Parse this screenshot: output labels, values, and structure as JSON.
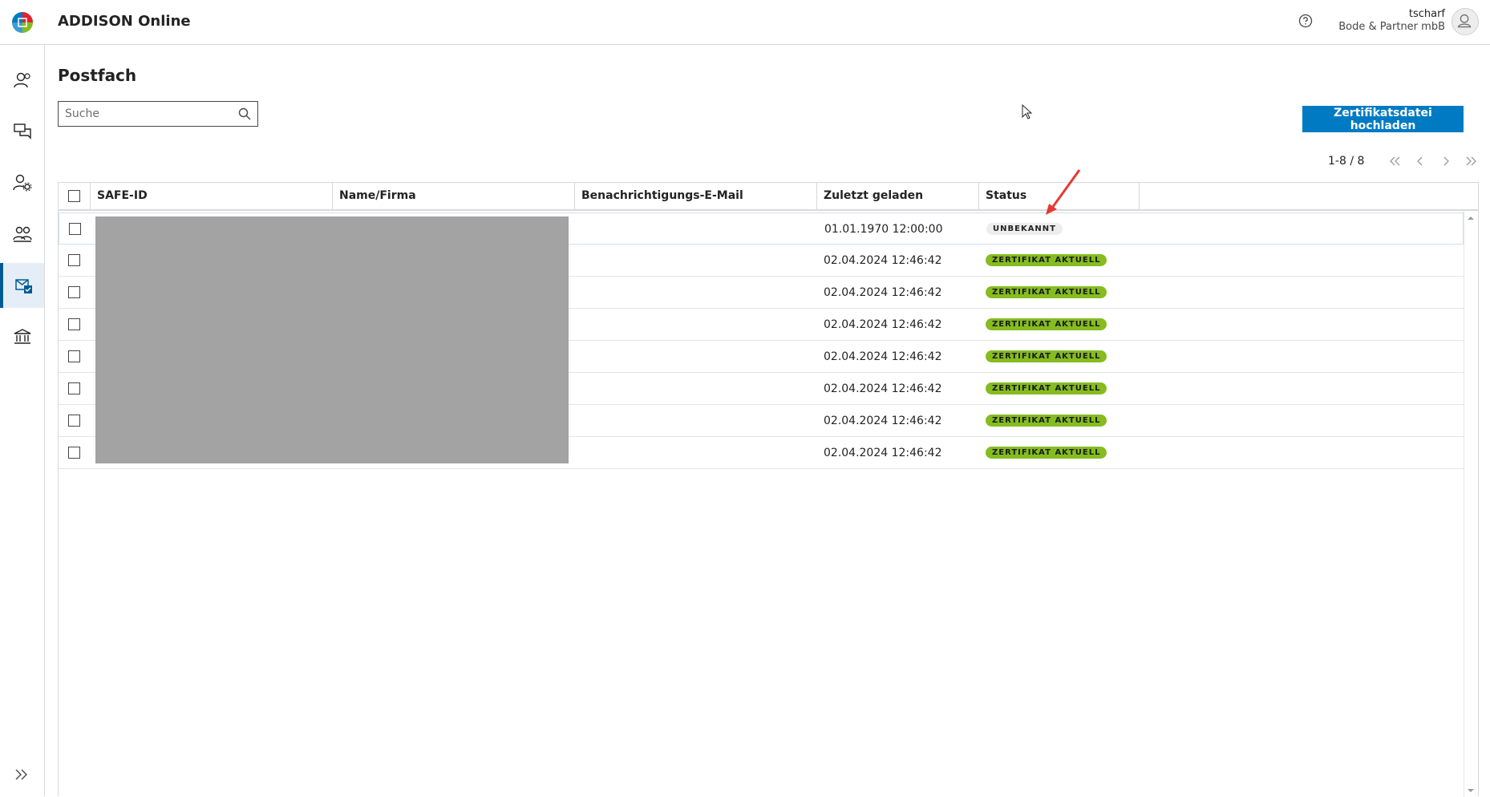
{
  "header": {
    "app_title": "ADDISON Online",
    "help_icon": "question-circle-icon",
    "user_name": "tscharf",
    "user_company": "Bode & Partner mbB",
    "avatar_icon": "user-icon"
  },
  "sidebar": {
    "items": [
      {
        "icon": "clients-icon",
        "active": false
      },
      {
        "icon": "chat-icon",
        "active": false
      },
      {
        "icon": "user-settings-icon",
        "active": false
      },
      {
        "icon": "group-icon",
        "active": false
      },
      {
        "icon": "mailbox-icon",
        "active": true
      },
      {
        "icon": "bank-icon",
        "active": false
      }
    ],
    "expand_icon": "double-chevron-right-icon"
  },
  "main": {
    "page_title": "Postfach",
    "search": {
      "placeholder": "Suche",
      "value": ""
    },
    "upload_button": "Zertifikatsdatei hochladen",
    "pagination": {
      "label": "1-8 / 8"
    }
  },
  "table": {
    "columns": [
      "SAFE-ID",
      "Name/Firma",
      "Benachrichtigungs-E-Mail",
      "Zuletzt geladen",
      "Status"
    ],
    "rows": [
      {
        "safe_id": "",
        "name": "",
        "email": "",
        "loaded": "01.01.1970 12:00:00",
        "status": "UNBEKANNT",
        "status_type": "unknown"
      },
      {
        "safe_id": "",
        "name": "",
        "email": "",
        "loaded": "02.04.2024 12:46:42",
        "status": "ZERTIFIKAT AKTUELL",
        "status_type": "current"
      },
      {
        "safe_id": "",
        "name": "",
        "email": "",
        "loaded": "02.04.2024 12:46:42",
        "status": "ZERTIFIKAT AKTUELL",
        "status_type": "current"
      },
      {
        "safe_id": "",
        "name": "",
        "email": "",
        "loaded": "02.04.2024 12:46:42",
        "status": "ZERTIFIKAT AKTUELL",
        "status_type": "current"
      },
      {
        "safe_id": "",
        "name": "",
        "email": "",
        "loaded": "02.04.2024 12:46:42",
        "status": "ZERTIFIKAT AKTUELL",
        "status_type": "current"
      },
      {
        "safe_id": "",
        "name": "",
        "email": "",
        "loaded": "02.04.2024 12:46:42",
        "status": "ZERTIFIKAT AKTUELL",
        "status_type": "current"
      },
      {
        "safe_id": "",
        "name": "",
        "email": "",
        "loaded": "02.04.2024 12:46:42",
        "status": "ZERTIFIKAT AKTUELL",
        "status_type": "current"
      },
      {
        "safe_id": "",
        "name": "",
        "email": "",
        "loaded": "02.04.2024 12:46:42",
        "status": "ZERTIFIKAT AKTUELL",
        "status_type": "current"
      }
    ]
  },
  "colors": {
    "primary": "#007ac3",
    "status_current": "#85bc20",
    "status_unknown": "#ededed",
    "annotation_arrow": "#e53935"
  }
}
